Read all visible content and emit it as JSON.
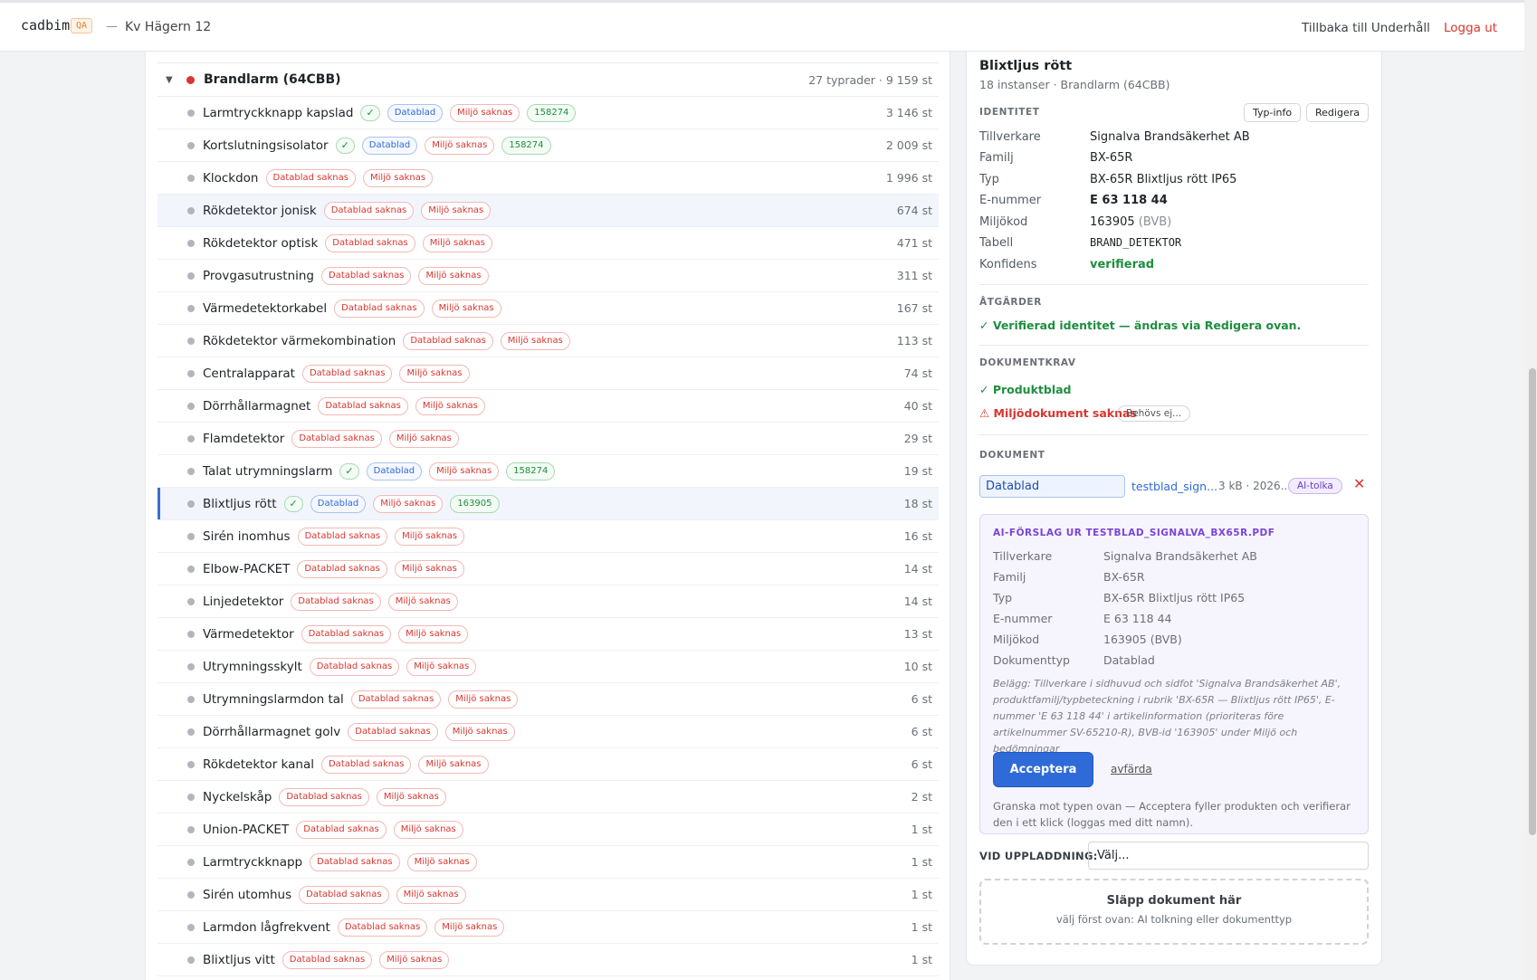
{
  "header": {
    "brand": "cadbim",
    "env_badge": "QA",
    "separator": "—",
    "project": "Kv Hägern 12",
    "back_link": "Tillbaka till Underhåll",
    "logout_link": "Logga ut"
  },
  "group": {
    "caret": "▼",
    "title": "Brandlarm (64CBB)",
    "meta": "27 typrader · 9 159 st"
  },
  "rows": [
    {
      "name": "Larmtryckknapp kapslad",
      "tags": [
        {
          "t": "✓",
          "c": "check"
        },
        {
          "t": "Datablad",
          "c": "blue"
        },
        {
          "t": "Miljö saknas",
          "c": "red"
        },
        {
          "t": "158274",
          "c": "green"
        }
      ],
      "count": "3 146 st"
    },
    {
      "name": "Kortslutningsisolator",
      "tags": [
        {
          "t": "✓",
          "c": "check"
        },
        {
          "t": "Datablad",
          "c": "blue"
        },
        {
          "t": "Miljö saknas",
          "c": "red"
        },
        {
          "t": "158274",
          "c": "green"
        }
      ],
      "count": "2 009 st"
    },
    {
      "name": "Klockdon",
      "tags": [
        {
          "t": "Datablad saknas",
          "c": "red"
        },
        {
          "t": "Miljö saknas",
          "c": "red"
        }
      ],
      "count": "1 996 st"
    },
    {
      "name": "Rökdetektor jonisk",
      "tags": [
        {
          "t": "Datablad saknas",
          "c": "red"
        },
        {
          "t": "Miljö saknas",
          "c": "red"
        }
      ],
      "count": "674 st",
      "hl": true
    },
    {
      "name": "Rökdetektor optisk",
      "tags": [
        {
          "t": "Datablad saknas",
          "c": "red"
        },
        {
          "t": "Miljö saknas",
          "c": "red"
        }
      ],
      "count": "471 st"
    },
    {
      "name": "Provgasutrustning",
      "tags": [
        {
          "t": "Datablad saknas",
          "c": "red"
        },
        {
          "t": "Miljö saknas",
          "c": "red"
        }
      ],
      "count": "311 st"
    },
    {
      "name": "Värmedetektorkabel",
      "tags": [
        {
          "t": "Datablad saknas",
          "c": "red"
        },
        {
          "t": "Miljö saknas",
          "c": "red"
        }
      ],
      "count": "167 st"
    },
    {
      "name": "Rökdetektor värmekombination",
      "tags": [
        {
          "t": "Datablad saknas",
          "c": "red"
        },
        {
          "t": "Miljö saknas",
          "c": "red"
        }
      ],
      "count": "113 st"
    },
    {
      "name": "Centralapparat",
      "tags": [
        {
          "t": "Datablad saknas",
          "c": "red"
        },
        {
          "t": "Miljö saknas",
          "c": "red"
        }
      ],
      "count": "74 st"
    },
    {
      "name": "Dörrhållarmagnet",
      "tags": [
        {
          "t": "Datablad saknas",
          "c": "red"
        },
        {
          "t": "Miljö saknas",
          "c": "red"
        }
      ],
      "count": "40 st"
    },
    {
      "name": "Flamdetektor",
      "tags": [
        {
          "t": "Datablad saknas",
          "c": "red"
        },
        {
          "t": "Miljö saknas",
          "c": "red"
        }
      ],
      "count": "29 st"
    },
    {
      "name": "Talat utrymningslarm",
      "tags": [
        {
          "t": "✓",
          "c": "check"
        },
        {
          "t": "Datablad",
          "c": "blue"
        },
        {
          "t": "Miljö saknas",
          "c": "red"
        },
        {
          "t": "158274",
          "c": "green"
        }
      ],
      "count": "19 st"
    },
    {
      "name": "Blixtljus rött",
      "tags": [
        {
          "t": "✓",
          "c": "check"
        },
        {
          "t": "Datablad",
          "c": "blue"
        },
        {
          "t": "Miljö saknas",
          "c": "red"
        },
        {
          "t": "163905",
          "c": "green"
        }
      ],
      "count": "18 st",
      "sel": true
    },
    {
      "name": "Sirén inomhus",
      "tags": [
        {
          "t": "Datablad saknas",
          "c": "red"
        },
        {
          "t": "Miljö saknas",
          "c": "red"
        }
      ],
      "count": "16 st"
    },
    {
      "name": "Elbow-PACKET",
      "tags": [
        {
          "t": "Datablad saknas",
          "c": "red"
        },
        {
          "t": "Miljö saknas",
          "c": "red"
        }
      ],
      "count": "14 st"
    },
    {
      "name": "Linjedetektor",
      "tags": [
        {
          "t": "Datablad saknas",
          "c": "red"
        },
        {
          "t": "Miljö saknas",
          "c": "red"
        }
      ],
      "count": "14 st"
    },
    {
      "name": "Värmedetektor",
      "tags": [
        {
          "t": "Datablad saknas",
          "c": "red"
        },
        {
          "t": "Miljö saknas",
          "c": "red"
        }
      ],
      "count": "13 st"
    },
    {
      "name": "Utrymningsskylt",
      "tags": [
        {
          "t": "Datablad saknas",
          "c": "red"
        },
        {
          "t": "Miljö saknas",
          "c": "red"
        }
      ],
      "count": "10 st"
    },
    {
      "name": "Utrymningslarmdon tal",
      "tags": [
        {
          "t": "Datablad saknas",
          "c": "red"
        },
        {
          "t": "Miljö saknas",
          "c": "red"
        }
      ],
      "count": "6 st"
    },
    {
      "name": "Dörrhållarmagnet golv",
      "tags": [
        {
          "t": "Datablad saknas",
          "c": "red"
        },
        {
          "t": "Miljö saknas",
          "c": "red"
        }
      ],
      "count": "6 st"
    },
    {
      "name": "Rökdetektor kanal",
      "tags": [
        {
          "t": "Datablad saknas",
          "c": "red"
        },
        {
          "t": "Miljö saknas",
          "c": "red"
        }
      ],
      "count": "6 st"
    },
    {
      "name": "Nyckelskåp",
      "tags": [
        {
          "t": "Datablad saknas",
          "c": "red"
        },
        {
          "t": "Miljö saknas",
          "c": "red"
        }
      ],
      "count": "2 st"
    },
    {
      "name": "Union-PACKET",
      "tags": [
        {
          "t": "Datablad saknas",
          "c": "red"
        },
        {
          "t": "Miljö saknas",
          "c": "red"
        }
      ],
      "count": "1 st"
    },
    {
      "name": "Larmtryckknapp",
      "tags": [
        {
          "t": "Datablad saknas",
          "c": "red"
        },
        {
          "t": "Miljö saknas",
          "c": "red"
        }
      ],
      "count": "1 st"
    },
    {
      "name": "Sirén utomhus",
      "tags": [
        {
          "t": "Datablad saknas",
          "c": "red"
        },
        {
          "t": "Miljö saknas",
          "c": "red"
        }
      ],
      "count": "1 st"
    },
    {
      "name": "Larmdon lågfrekvent",
      "tags": [
        {
          "t": "Datablad saknas",
          "c": "red"
        },
        {
          "t": "Miljö saknas",
          "c": "red"
        }
      ],
      "count": "1 st"
    },
    {
      "name": "Blixtljus vitt",
      "tags": [
        {
          "t": "Datablad saknas",
          "c": "red"
        },
        {
          "t": "Miljö saknas",
          "c": "red"
        }
      ],
      "count": "1 st"
    }
  ],
  "detail": {
    "title": "Blixtljus rött",
    "subtitle": "18 instanser · Brandlarm (64CBB)",
    "identity_label": "IDENTITET",
    "type_info_btn": "Typ-info",
    "edit_btn": "Redigera",
    "identity": {
      "manufacturer_k": "Tillverkare",
      "manufacturer_v": "Signalva Brandsäkerhet AB",
      "family_k": "Familj",
      "family_v": "BX-65R",
      "type_k": "Typ",
      "type_v": "BX-65R Blixtljus rött IP65",
      "enr_k": "E-nummer",
      "enr_v": "E 63 118 44",
      "env_k": "Miljökod",
      "env_v": "163905",
      "env_suffix": "(BVB)",
      "table_k": "Tabell",
      "table_v": "BRAND_DETEKTOR",
      "conf_k": "Konfidens",
      "conf_v": "verifierad"
    },
    "actions_label": "ÅTGÄRDER",
    "actions_text": "✓ Verifierad identitet — ändras via Redigera ovan.",
    "docreq_label": "DOKUMENTKRAV",
    "docreq_ok": "✓ Produktblad",
    "docreq_missing": "⚠ Miljödokument saknas",
    "docreq_pill": "Behövs ej...",
    "docs_label": "DOKUMENT",
    "doc_type": "Datablad",
    "doc_file": "testblad_sign...",
    "doc_meta": "3 kB · 2026...",
    "ai_btn": "AI-tolka",
    "remove_icon": "✕",
    "ai": {
      "head": "AI-FÖRSLAG UR TESTBLAD_SIGNALVA_BX65R.PDF",
      "manufacturer_k": "Tillverkare",
      "manufacturer_v": "Signalva Brandsäkerhet AB",
      "family_k": "Familj",
      "family_v": "BX-65R",
      "type_k": "Typ",
      "type_v": "BX-65R Blixtljus rött IP65",
      "enr_k": "E-nummer",
      "enr_v": "E 63 118 44",
      "env_k": "Miljökod",
      "env_v": "163905 (BVB)",
      "doctype_k": "Dokumenttyp",
      "doctype_v": "Datablad",
      "note": "Belägg: Tillverkare i sidhuvud och sidfot 'Signalva Brandsäkerhet AB', produktfamilj/typbeteckning i rubrik 'BX-65R — Blixtljus rött IP65', E-nummer 'E 63 118 44' i artikelinformation (prioriteras före artikelnummer SV-65210-R), BVB-id '163905' under Miljö och bedömningar",
      "accept": "Acceptera",
      "dismiss": "avfärda",
      "foot": "Granska mot typen ovan — Acceptera fyller produkten och verifierar den i ett klick (loggas med ditt namn)."
    },
    "upload_label": "VID UPPLADDNING:",
    "upload_select": "Välj...",
    "dropzone_title": "Släpp dokument här",
    "dropzone_sub": "välj först ovan: AI tolkning eller dokumenttyp"
  }
}
